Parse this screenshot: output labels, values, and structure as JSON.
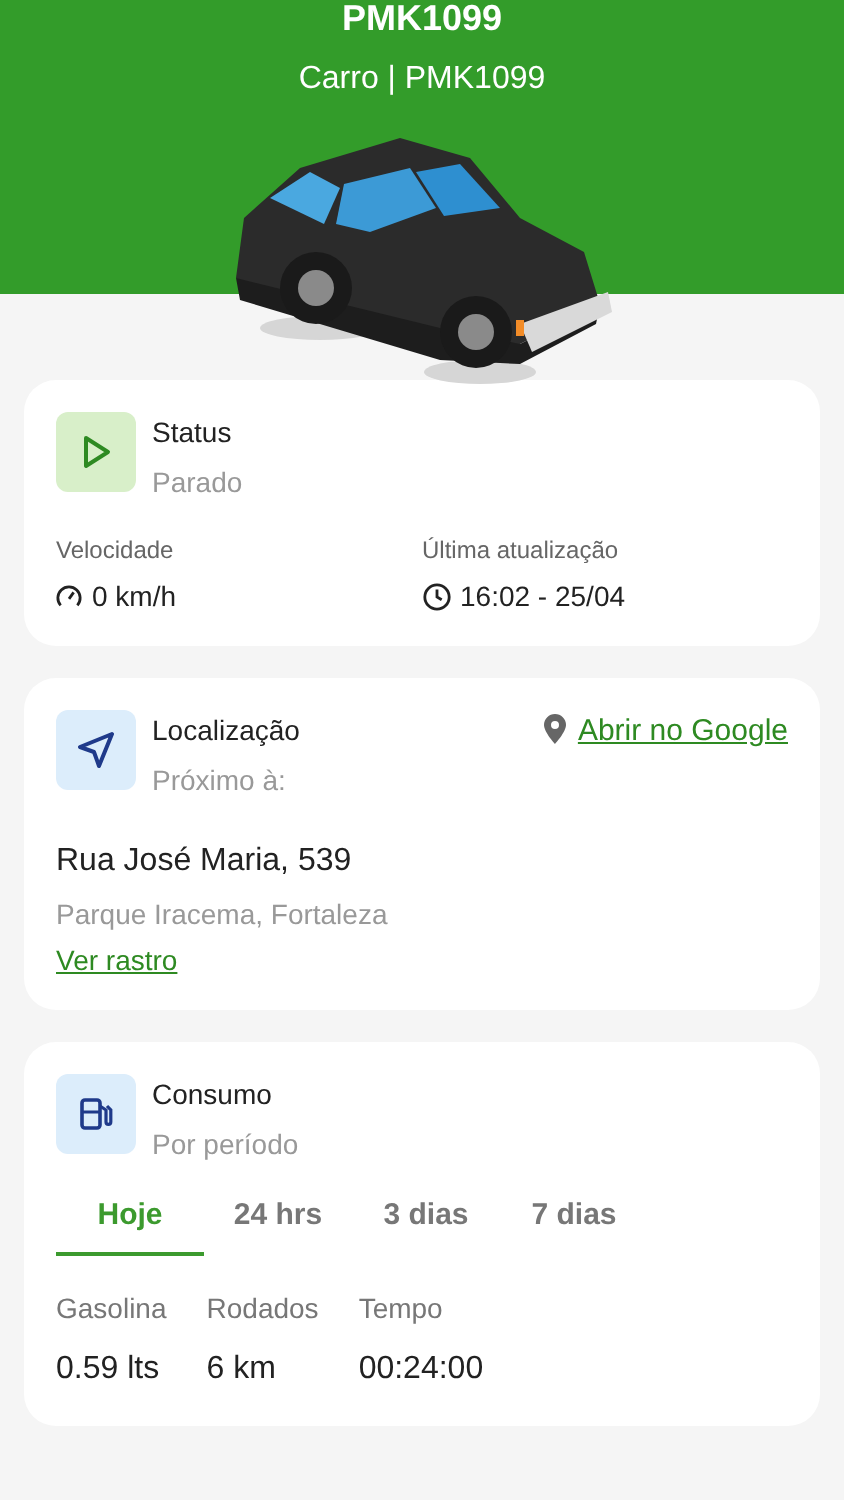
{
  "header": {
    "title": "PMK1099",
    "subtitle": "Carro | PMK1099"
  },
  "status_card": {
    "title": "Status",
    "value": "Parado",
    "speed_label": "Velocidade",
    "speed": "0 km/h",
    "update_label": "Última atualização",
    "update": "16:02 - 25/04"
  },
  "location_card": {
    "title": "Localização",
    "subtitle": "Próximo à:",
    "google_link": "Abrir no Google",
    "street": "Rua José Maria, 539",
    "district": "Parque Iracema, Fortaleza",
    "track_link": "Ver rastro"
  },
  "consumption_card": {
    "title": "Consumo",
    "subtitle": "Por período",
    "tabs": [
      {
        "label": "Hoje",
        "selected": true
      },
      {
        "label": "24 hrs",
        "selected": false
      },
      {
        "label": "3 dias",
        "selected": false
      },
      {
        "label": "7 dias",
        "selected": false
      }
    ],
    "metrics": [
      {
        "label": "Gasolina",
        "value": "0.59 lts"
      },
      {
        "label": "Rodados",
        "value": "6 km"
      },
      {
        "label": "Tempo",
        "value": "00:24:00"
      }
    ]
  }
}
